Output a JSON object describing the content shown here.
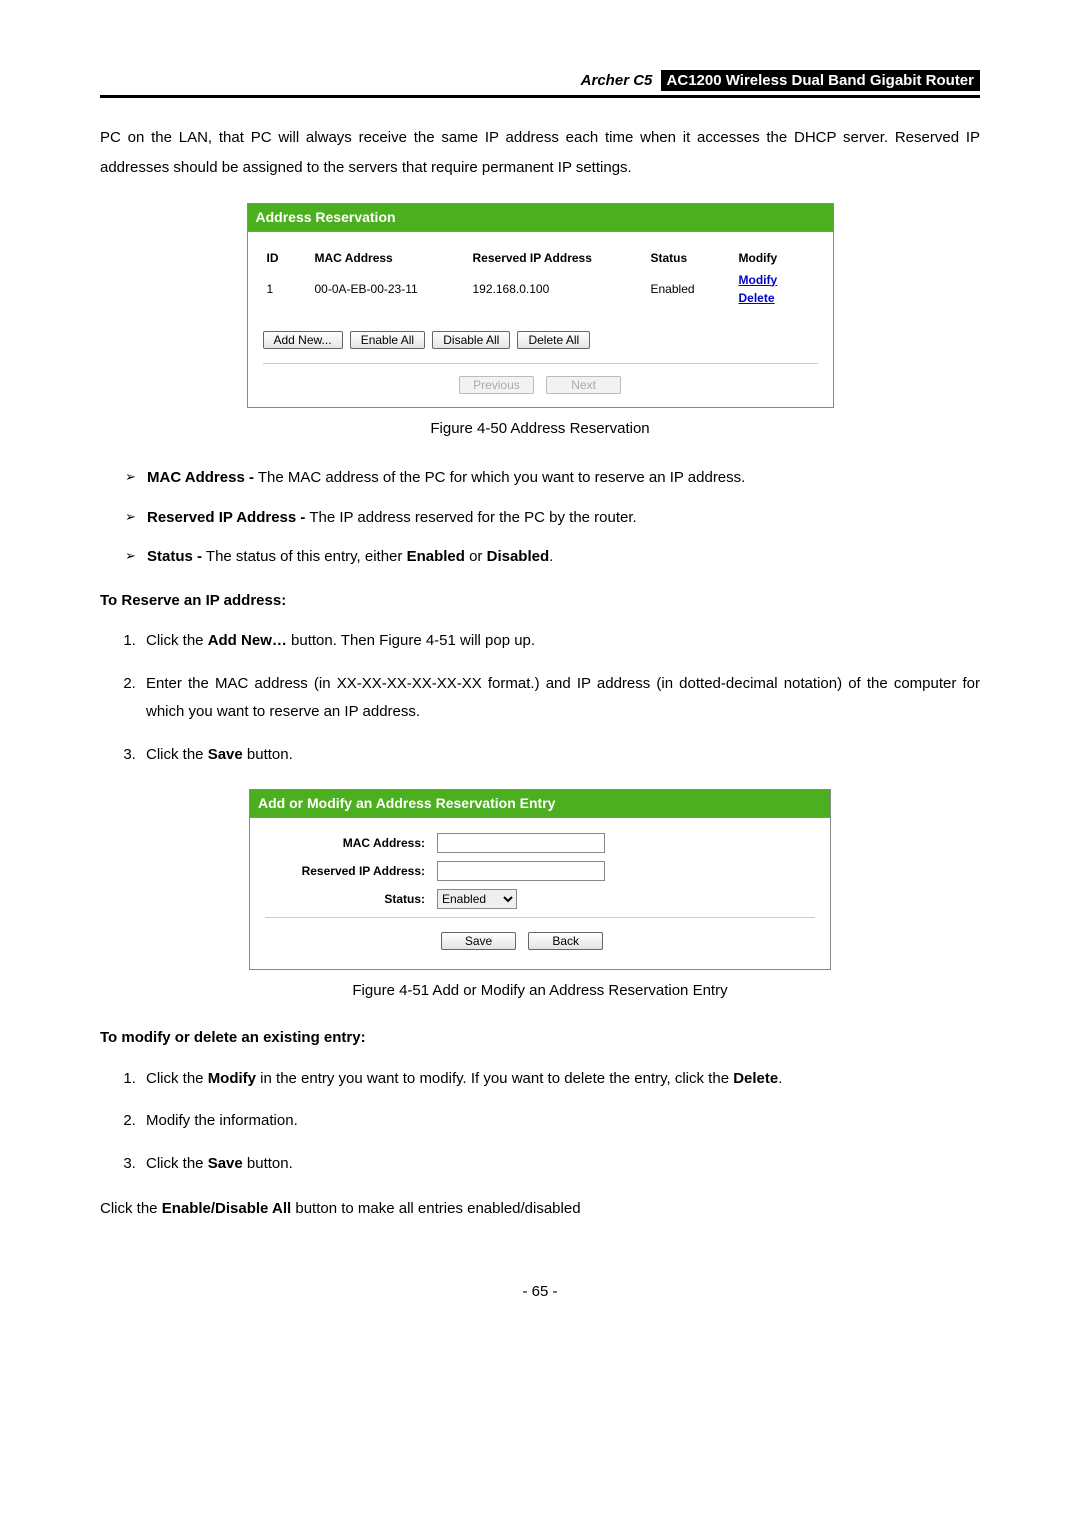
{
  "header": {
    "model": "Archer C5",
    "product": "AC1200 Wireless Dual Band Gigabit Router"
  },
  "intro": "PC on the LAN, that PC will always receive the same IP address each time when it accesses the DHCP server. Reserved IP addresses should be assigned to the servers that require permanent IP settings.",
  "fig1": {
    "title": "Address Reservation",
    "columns": {
      "id": "ID",
      "mac": "MAC Address",
      "ip": "Reserved IP Address",
      "status": "Status",
      "modify": "Modify"
    },
    "row": {
      "id": "1",
      "mac": "00-0A-EB-00-23-11",
      "ip": "192.168.0.100",
      "status": "Enabled",
      "modify": "Modify",
      "delete": "Delete"
    },
    "buttons": {
      "addnew": "Add New...",
      "enableall": "Enable All",
      "disableall": "Disable All",
      "deleteall": "Delete All",
      "prev": "Previous",
      "next": "Next"
    },
    "caption": "Figure 4-50 Address Reservation"
  },
  "bullets": {
    "mac_b": "MAC Address -",
    "mac_t": " The MAC address of the PC for which you want to reserve an IP address.",
    "ip_b": "Reserved IP Address -",
    "ip_t": " The IP address reserved for the PC by the router.",
    "st_b": "Status -",
    "st_t1": " The status of this entry, either ",
    "st_en": "Enabled",
    "st_or": " or ",
    "st_di": "Disabled",
    "st_dot": "."
  },
  "reserve_head": "To Reserve an IP address:",
  "reserve_steps": {
    "s1a": "Click the ",
    "s1b": "Add New…",
    "s1c": " button. Then Figure 4-51 will pop up.",
    "s2": "Enter the MAC address (in XX-XX-XX-XX-XX-XX format.) and IP address (in dotted-decimal notation) of the computer for which you want to reserve an IP address.",
    "s3a": "Click the ",
    "s3b": "Save",
    "s3c": " button."
  },
  "fig2": {
    "title": "Add or Modify an Address Reservation Entry",
    "labels": {
      "mac": "MAC Address:",
      "ip": "Reserved IP Address:",
      "status": "Status:"
    },
    "status_value": "Enabled",
    "buttons": {
      "save": "Save",
      "back": "Back"
    },
    "caption": "Figure 4-51 Add or Modify an Address Reservation Entry"
  },
  "modify_head": "To modify or delete an existing entry:",
  "modify_steps": {
    "s1a": "Click the ",
    "s1b": "Modify",
    "s1c": " in the entry you want to modify. If you want to delete the entry, click the ",
    "s1d": "Delete",
    "s1e": ".",
    "s2": "Modify the information.",
    "s3a": "Click the ",
    "s3b": "Save",
    "s3c": " button."
  },
  "footer_line": {
    "a": "Click the ",
    "b": "Enable/Disable All",
    "c": " button to make all entries enabled/disabled"
  },
  "page_num": "- 65 -"
}
